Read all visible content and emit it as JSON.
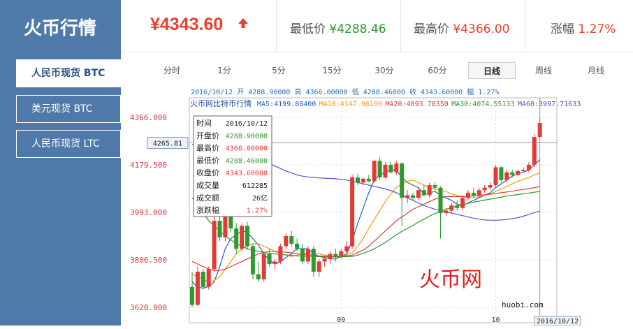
{
  "app_title": "火币行情",
  "sidebar": {
    "items": [
      {
        "label": "人民币现货 BTC",
        "active": true
      },
      {
        "label": "美元现货 BTC",
        "active": false
      },
      {
        "label": "人民币现货 LTC",
        "active": false
      }
    ]
  },
  "header": {
    "price": "¥4343.60",
    "trend_icon": "arrow-up-icon",
    "low_label": "最低价",
    "low_value": "¥4288.46",
    "high_label": "最高价",
    "high_value": "¥4366.00",
    "change_label": "涨幅",
    "change_value": "1.27%"
  },
  "periods": [
    {
      "label": "分时",
      "active": false
    },
    {
      "label": "1分",
      "active": false
    },
    {
      "label": "5分",
      "active": false
    },
    {
      "label": "15分",
      "active": false
    },
    {
      "label": "30分",
      "active": false
    },
    {
      "label": "60分",
      "active": false
    },
    {
      "label": "日线",
      "active": true
    },
    {
      "label": "周线",
      "active": false
    },
    {
      "label": "月线",
      "active": false
    }
  ],
  "chart_data": {
    "type": "candlestick",
    "summary_line": "2016/10/12 开 4288.90000 高 4366.00000 低 4288.46000 收 4343.60000 幅 1.27%",
    "title": "火币网比特币行情",
    "ma_legend": [
      {
        "label": "MA5:4199.88400",
        "color": "#1f5fbf"
      },
      {
        "label": "MA10:4147.96100",
        "color": "#f39c12"
      },
      {
        "label": "MA20:4093.78350",
        "color": "#e03b3b"
      },
      {
        "label": "MA30:4074.55133",
        "color": "#2e9a2e"
      },
      {
        "label": "MA60:3997.71633",
        "color": "#5a4fcf"
      }
    ],
    "y_ticks": [
      "4366.000",
      "4179.500",
      "3993.000",
      "3806.500",
      "3620.000"
    ],
    "ylim": [
      3620,
      4366
    ],
    "crosshair_value": "4265.81",
    "x_ticks": [
      "09",
      "10"
    ],
    "x_cursor_label": "2016/10/12",
    "watermark": "火币网",
    "site": "huobi.com",
    "up_color": "#e53935",
    "down_color": "#2e9a2e",
    "tooltip": {
      "rows": [
        {
          "label": "时间",
          "value": "2016/10/12",
          "color": "#222222"
        },
        {
          "label": "开盘价",
          "value": "4288.90000",
          "color": "#2e9a2e"
        },
        {
          "label": "最高价",
          "value": "4366.00000",
          "color": "#e53935"
        },
        {
          "label": "最低价",
          "value": "4288.46000",
          "color": "#2e9a2e"
        },
        {
          "label": "收盘价",
          "value": "4343.60000",
          "color": "#e53935"
        },
        {
          "label": "成交量",
          "value": "612285",
          "color": "#222222"
        },
        {
          "label": "成交额",
          "value": "26亿",
          "color": "#222222"
        },
        {
          "label": "涨跌幅",
          "value": "1.27%",
          "color": "#e53935"
        }
      ]
    },
    "candles": [
      {
        "o": 3700,
        "h": 3760,
        "l": 3620,
        "c": 3630
      },
      {
        "o": 3630,
        "h": 3780,
        "l": 3625,
        "c": 3760
      },
      {
        "o": 3760,
        "h": 3770,
        "l": 3695,
        "c": 3700
      },
      {
        "o": 3700,
        "h": 3780,
        "l": 3690,
        "c": 3770
      },
      {
        "o": 3770,
        "h": 3980,
        "l": 3760,
        "c": 3960
      },
      {
        "o": 3960,
        "h": 3975,
        "l": 3880,
        "c": 3895
      },
      {
        "o": 3895,
        "h": 4010,
        "l": 3880,
        "c": 3980
      },
      {
        "o": 3980,
        "h": 4000,
        "l": 3915,
        "c": 3930
      },
      {
        "o": 3930,
        "h": 3950,
        "l": 3830,
        "c": 3850
      },
      {
        "o": 3850,
        "h": 3950,
        "l": 3840,
        "c": 3940
      },
      {
        "o": 3940,
        "h": 3955,
        "l": 3845,
        "c": 3860
      },
      {
        "o": 3860,
        "h": 3870,
        "l": 3730,
        "c": 3750
      },
      {
        "o": 3750,
        "h": 3800,
        "l": 3720,
        "c": 3730
      },
      {
        "o": 3730,
        "h": 3840,
        "l": 3720,
        "c": 3830
      },
      {
        "o": 3830,
        "h": 3850,
        "l": 3780,
        "c": 3790
      },
      {
        "o": 3790,
        "h": 3810,
        "l": 3770,
        "c": 3800
      },
      {
        "o": 3800,
        "h": 3870,
        "l": 3790,
        "c": 3860
      },
      {
        "o": 3860,
        "h": 3910,
        "l": 3850,
        "c": 3900
      },
      {
        "o": 3900,
        "h": 3920,
        "l": 3860,
        "c": 3870
      },
      {
        "o": 3870,
        "h": 3890,
        "l": 3840,
        "c": 3850
      },
      {
        "o": 3850,
        "h": 3870,
        "l": 3790,
        "c": 3800
      },
      {
        "o": 3800,
        "h": 3860,
        "l": 3790,
        "c": 3850
      },
      {
        "o": 3850,
        "h": 3860,
        "l": 3740,
        "c": 3760
      },
      {
        "o": 3760,
        "h": 3810,
        "l": 3740,
        "c": 3800
      },
      {
        "o": 3800,
        "h": 3820,
        "l": 3780,
        "c": 3810
      },
      {
        "o": 3810,
        "h": 3840,
        "l": 3790,
        "c": 3830
      },
      {
        "o": 3830,
        "h": 3850,
        "l": 3800,
        "c": 3820
      },
      {
        "o": 3820,
        "h": 3850,
        "l": 3810,
        "c": 3840
      },
      {
        "o": 3840,
        "h": 3880,
        "l": 3830,
        "c": 3860
      },
      {
        "o": 3860,
        "h": 4140,
        "l": 3850,
        "c": 4130
      },
      {
        "o": 4130,
        "h": 4145,
        "l": 4100,
        "c": 4110
      },
      {
        "o": 4110,
        "h": 4130,
        "l": 4100,
        "c": 4125
      },
      {
        "o": 4125,
        "h": 4140,
        "l": 4110,
        "c": 4115
      },
      {
        "o": 4115,
        "h": 4200,
        "l": 4110,
        "c": 4195
      },
      {
        "o": 4195,
        "h": 4210,
        "l": 4120,
        "c": 4130
      },
      {
        "o": 4130,
        "h": 4190,
        "l": 4125,
        "c": 4180
      },
      {
        "o": 4180,
        "h": 4190,
        "l": 4145,
        "c": 4150
      },
      {
        "o": 4150,
        "h": 4195,
        "l": 4140,
        "c": 4185
      },
      {
        "o": 4185,
        "h": 4190,
        "l": 3940,
        "c": 4050
      },
      {
        "o": 4050,
        "h": 4080,
        "l": 4030,
        "c": 4060
      },
      {
        "o": 4060,
        "h": 4070,
        "l": 4040,
        "c": 4050
      },
      {
        "o": 4050,
        "h": 4090,
        "l": 4040,
        "c": 4080
      },
      {
        "o": 4080,
        "h": 4100,
        "l": 4055,
        "c": 4060
      },
      {
        "o": 4060,
        "h": 4110,
        "l": 4050,
        "c": 4100
      },
      {
        "o": 4100,
        "h": 4110,
        "l": 4080,
        "c": 4090
      },
      {
        "o": 4090,
        "h": 4095,
        "l": 3890,
        "c": 3990
      },
      {
        "o": 3990,
        "h": 4010,
        "l": 3980,
        "c": 4000
      },
      {
        "o": 4000,
        "h": 4030,
        "l": 3990,
        "c": 4020
      },
      {
        "o": 4020,
        "h": 4040,
        "l": 4000,
        "c": 4010
      },
      {
        "o": 4010,
        "h": 4060,
        "l": 4000,
        "c": 4050
      },
      {
        "o": 4050,
        "h": 4080,
        "l": 4040,
        "c": 4070
      },
      {
        "o": 4070,
        "h": 4090,
        "l": 4050,
        "c": 4060
      },
      {
        "o": 4060,
        "h": 4090,
        "l": 4050,
        "c": 4080
      },
      {
        "o": 4080,
        "h": 4100,
        "l": 4070,
        "c": 4090
      },
      {
        "o": 4090,
        "h": 4110,
        "l": 4080,
        "c": 4100
      },
      {
        "o": 4100,
        "h": 4180,
        "l": 4090,
        "c": 4170
      },
      {
        "o": 4170,
        "h": 4175,
        "l": 4110,
        "c": 4120
      },
      {
        "o": 4120,
        "h": 4160,
        "l": 4110,
        "c": 4150
      },
      {
        "o": 4150,
        "h": 4160,
        "l": 4130,
        "c": 4140
      },
      {
        "o": 4140,
        "h": 4160,
        "l": 4135,
        "c": 4155
      },
      {
        "o": 4155,
        "h": 4170,
        "l": 4150,
        "c": 4160
      },
      {
        "o": 4160,
        "h": 4190,
        "l": 4150,
        "c": 4180
      },
      {
        "o": 4180,
        "h": 4300,
        "l": 4170,
        "c": 4289
      },
      {
        "o": 4289,
        "h": 4366,
        "l": 4288,
        "c": 4344
      }
    ],
    "ma_series": [
      {
        "name": "MA5",
        "color": "#1f5fbf",
        "values": [
          3720,
          3700,
          3695,
          3702,
          3720,
          3780,
          3850,
          3890,
          3905,
          3920,
          3915,
          3890,
          3865,
          3830,
          3805,
          3790,
          3800,
          3815,
          3830,
          3850,
          3850,
          3850,
          3830,
          3820,
          3815,
          3810,
          3810,
          3820,
          3830,
          3880,
          3950,
          4010,
          4070,
          4120,
          4140,
          4150,
          4160,
          4160,
          4130,
          4110,
          4100,
          4090,
          4065,
          4070,
          4075,
          4060,
          4050,
          4040,
          4025,
          4020,
          4030,
          4040,
          4050,
          4060,
          4070,
          4090,
          4105,
          4120,
          4135,
          4145,
          4150,
          4160,
          4180,
          4200
        ]
      },
      {
        "name": "MA10",
        "color": "#f39c12",
        "values": [
          3750,
          3740,
          3730,
          3720,
          3725,
          3740,
          3770,
          3800,
          3830,
          3850,
          3860,
          3870,
          3870,
          3860,
          3850,
          3840,
          3830,
          3825,
          3820,
          3825,
          3830,
          3832,
          3832,
          3830,
          3825,
          3822,
          3820,
          3822,
          3825,
          3835,
          3860,
          3890,
          3930,
          3965,
          4000,
          4035,
          4065,
          4090,
          4105,
          4115,
          4120,
          4110,
          4100,
          4090,
          4085,
          4080,
          4075,
          4065,
          4060,
          4055,
          4050,
          4050,
          4055,
          4060,
          4065,
          4075,
          4085,
          4095,
          4105,
          4115,
          4122,
          4130,
          4140,
          4148
        ]
      },
      {
        "name": "MA20",
        "color": "#e03b3b",
        "values": [
          3800,
          3790,
          3780,
          3770,
          3765,
          3765,
          3770,
          3780,
          3790,
          3800,
          3810,
          3820,
          3830,
          3835,
          3840,
          3840,
          3838,
          3836,
          3834,
          3830,
          3828,
          3826,
          3824,
          3822,
          3821,
          3820,
          3820,
          3820,
          3822,
          3825,
          3835,
          3845,
          3860,
          3880,
          3900,
          3920,
          3940,
          3960,
          3975,
          3990,
          4005,
          4015,
          4025,
          4035,
          4045,
          4050,
          4055,
          4055,
          4055,
          4055,
          4056,
          4058,
          4060,
          4062,
          4064,
          4067,
          4070,
          4073,
          4076,
          4080,
          4083,
          4086,
          4090,
          4094
        ]
      },
      {
        "name": "MA30",
        "color": "#2e9a2e",
        "values": [
          4050,
          4020,
          3990,
          3960,
          3940,
          3920,
          3900,
          3885,
          3870,
          3860,
          3850,
          3845,
          3840,
          3835,
          3832,
          3830,
          3828,
          3826,
          3824,
          3822,
          3821,
          3820,
          3820,
          3819,
          3818,
          3818,
          3818,
          3818,
          3819,
          3820,
          3825,
          3832,
          3840,
          3850,
          3862,
          3875,
          3890,
          3905,
          3918,
          3930,
          3942,
          3955,
          3966,
          3978,
          3988,
          3998,
          4005,
          4012,
          4018,
          4023,
          4028,
          4033,
          4037,
          4041,
          4045,
          4049,
          4053,
          4057,
          4060,
          4063,
          4066,
          4069,
          4072,
          4075
        ]
      },
      {
        "name": "MA60",
        "color": "#5a4fcf",
        "values": [
          4260,
          4255,
          4250,
          4245,
          4242,
          4240,
          4238,
          4236,
          4234,
          4232,
          4225,
          4215,
          4205,
          4195,
          4185,
          4175,
          4165,
          4155,
          4148,
          4140,
          4135,
          4132,
          4130,
          4128,
          4127,
          4126,
          4125,
          4122,
          4120,
          4115,
          4110,
          4105,
          4100,
          4095,
          4090,
          4085,
          4078,
          4070,
          4060,
          4050,
          4040,
          4030,
          4020,
          4012,
          4005,
          4000,
          3995,
          3990,
          3985,
          3980,
          3975,
          3970,
          3966,
          3963,
          3962,
          3962,
          3963,
          3965,
          3968,
          3972,
          3978,
          3985,
          3992,
          3998
        ]
      }
    ]
  }
}
